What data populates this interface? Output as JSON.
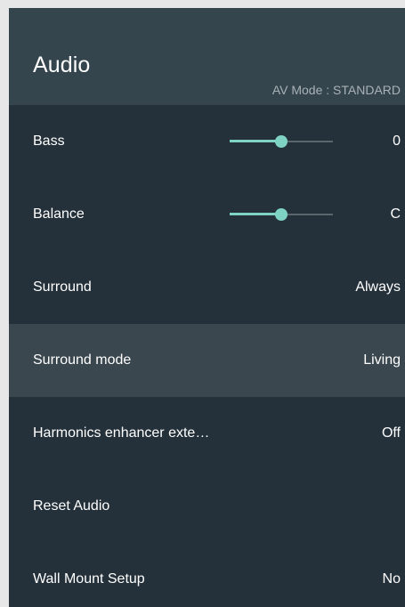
{
  "header": {
    "title": "Audio",
    "av_mode": "AV Mode : STANDARD"
  },
  "items": [
    {
      "label": "Bass",
      "value": "0",
      "slider": {
        "level": 0.5
      }
    },
    {
      "label": "Balance",
      "value": "C",
      "slider": {
        "level": 0.5
      }
    },
    {
      "label": "Surround",
      "value": "Always"
    },
    {
      "label": "Surround mode",
      "value": "Living",
      "selected": true
    },
    {
      "label": "Harmonics enhancer exte…",
      "value": "Off"
    },
    {
      "label": "Reset Audio",
      "value": ""
    },
    {
      "label": "Wall Mount Setup",
      "value": "No"
    }
  ],
  "colors": {
    "accent": "#7fd3c4",
    "panel_bg": "#24313a",
    "header_bg": "#34454e",
    "selected_bg": "#3a474e"
  }
}
